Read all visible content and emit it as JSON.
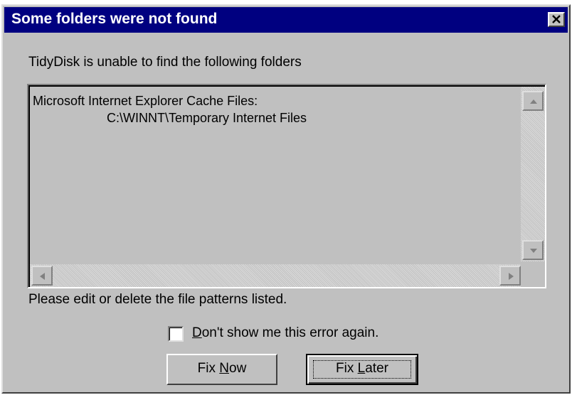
{
  "dialog": {
    "title": "Some folders were not found",
    "close_glyph": "×"
  },
  "message": "TidyDisk is unable to find the following folders",
  "folder_list": {
    "lines": [
      "Microsoft Internet Explorer Cache Files:",
      "C:\\WINNT\\Temporary Internet Files"
    ]
  },
  "instruction": "Please edit or delete the file patterns listed.",
  "checkbox": {
    "label_accel": "D",
    "label_rest": "on't show me this error again.",
    "checked": false
  },
  "buttons": {
    "fix_now": {
      "pre": "Fix ",
      "accel": "N",
      "post": "ow"
    },
    "fix_later": {
      "pre": "Fix ",
      "accel": "L",
      "post": "ater"
    }
  },
  "icons": {
    "close": "close-icon",
    "scroll_up": "arrow-up-icon",
    "scroll_down": "arrow-down-icon",
    "scroll_left": "arrow-left-icon",
    "scroll_right": "arrow-right-icon"
  },
  "colors": {
    "title_bar": "#000080",
    "face": "#c0c0c0",
    "title_text": "#ffffff"
  }
}
